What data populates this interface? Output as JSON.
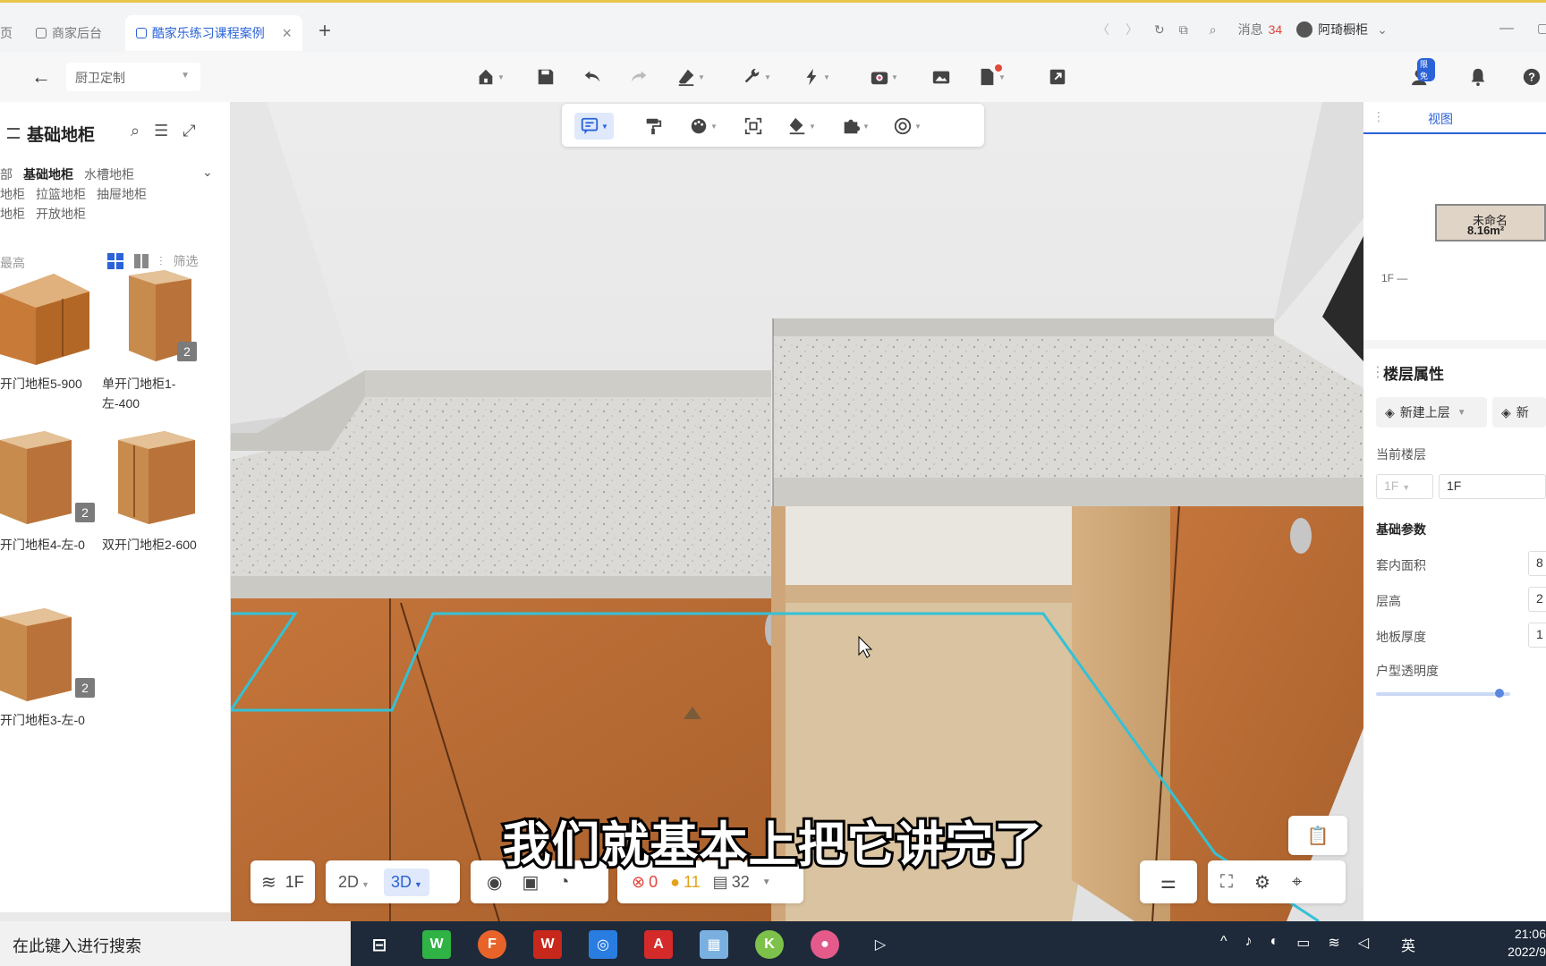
{
  "tabs": [
    {
      "label": "页"
    },
    {
      "label": "商家后台"
    },
    {
      "label": "酷家乐练习课程案例"
    }
  ],
  "window": {
    "messages_label": "消息",
    "messages_count": "34",
    "user": "阿琦橱柜"
  },
  "appbar": {
    "mode_select": "厨卫定制"
  },
  "left_panel": {
    "title": "基础地柜",
    "categories_row1": [
      "部",
      "基础地柜",
      "水槽地柜"
    ],
    "categories_row2": [
      "地柜",
      "拉篮地柜",
      "抽屉地柜"
    ],
    "categories_row3": [
      "地柜",
      "开放地柜"
    ],
    "sort_label": "最高",
    "filter_label": "筛选",
    "items": [
      {
        "name": "开门地柜5-900",
        "badge": ""
      },
      {
        "name": "单开门地柜1-左-400",
        "badge": "2"
      },
      {
        "name": "开门地柜4-左-0",
        "badge": "2"
      },
      {
        "name": "双开门地柜2-600",
        "badge": ""
      },
      {
        "name": "开门地柜3-左-0",
        "badge": "2"
      }
    ]
  },
  "right_panel": {
    "view_tab": "视图",
    "room_name": "未命名",
    "room_area": "8.16m²",
    "floor_marker": "1F",
    "floor_props_title": "楼层属性",
    "new_floor_up": "新建上层",
    "new_floor_down": "新",
    "current_floor_label": "当前楼层",
    "current_floor_select": "1F",
    "current_floor_value": "1F",
    "basic_params": "基础参数",
    "params": [
      {
        "label": "套内面积",
        "value": "8"
      },
      {
        "label": "层高",
        "value": "2"
      },
      {
        "label": "地板厚度",
        "value": "1"
      },
      {
        "label": "户型透明度",
        "value": ""
      }
    ],
    "transparency": 0.92
  },
  "bottom_bar": {
    "floor": "1F",
    "mode_2d": "2D",
    "mode_3d": "3D",
    "errors": "0",
    "warnings": "11",
    "items": "32"
  },
  "subtitle": "我们就基本上把它讲完了",
  "taskbar": {
    "search_placeholder": "在此键入进行搜索",
    "ime": "英",
    "time": "21:06",
    "date": "2022/9"
  },
  "colors": {
    "accent": "#2a62d8",
    "cabinet_wood": "#c77a3a",
    "countertop": "#d9d8d4",
    "outline": "#34c1d6"
  }
}
